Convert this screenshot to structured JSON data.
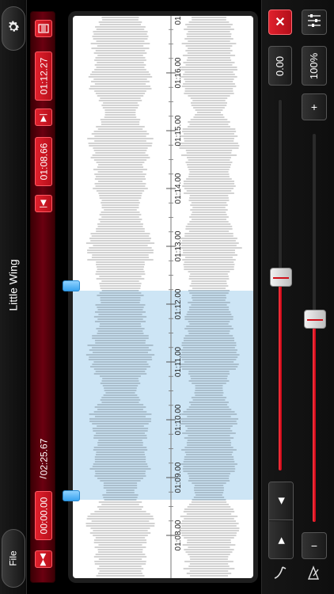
{
  "header": {
    "song_title": "Little Wing",
    "file_label": "File"
  },
  "icons": {
    "settings": "gear-icon",
    "skip_start": "skip-to-start-icon",
    "skip_end": "skip-to-end-icon",
    "skip_back": "skip-back-icon",
    "skip_fwd": "skip-forward-icon",
    "export": "export-icon",
    "close": "close-icon",
    "mixer": "mixer-icon",
    "metronome": "metronome-icon",
    "tuning": "tuning-fork-icon"
  },
  "time": {
    "current": "00:00.00",
    "separator": "/",
    "total": "02:25.67",
    "loop_start": "01:08.66",
    "loop_end": "01:12.27"
  },
  "timeline": {
    "labels": [
      "01:08.00",
      "01:09.00",
      "01:10.00",
      "01:11.00",
      "01:12.00",
      "01:13.00",
      "01:14.00",
      "01:15.00",
      "01:16.00",
      "01:17"
    ]
  },
  "controls": {
    "speed_value": "0.00",
    "pitch_value": "100%",
    "plus_label": "+",
    "minus_label": "−",
    "close_label": "✕",
    "nav_up": "◀",
    "nav_down": "▶",
    "speed_level": 0.52,
    "pitch_level": 0.52
  },
  "colors": {
    "accent_red": "#d7121f",
    "selection_blue": "#bcdcf2",
    "handle_blue": "#4aaef5"
  }
}
